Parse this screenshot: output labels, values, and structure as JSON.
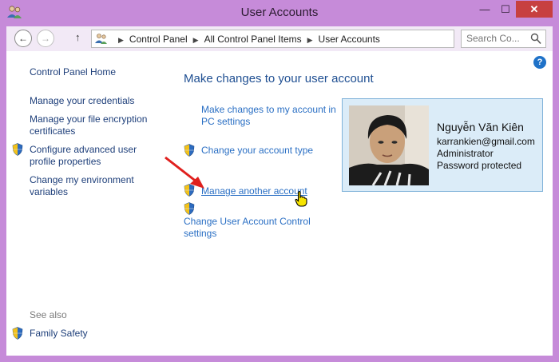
{
  "window": {
    "title": "User Accounts",
    "minimize": "—",
    "maximize": "☐",
    "close": "✕"
  },
  "nav": {
    "back": "←",
    "forward": "→",
    "up": "↑",
    "breadcrumbs": [
      "Control Panel",
      "All Control Panel Items",
      "User Accounts"
    ],
    "search_placeholder": "Search Co...",
    "refresh": "↻"
  },
  "sidebar": {
    "home": "Control Panel Home",
    "items": [
      {
        "label": "Manage your credentials",
        "shield": false
      },
      {
        "label": "Manage your file encryption certificates",
        "shield": false
      },
      {
        "label": "Configure advanced user profile properties",
        "shield": true
      },
      {
        "label": "Change my environment variables",
        "shield": false
      }
    ],
    "see_also": "See also",
    "see_also_items": [
      {
        "label": "Family Safety",
        "shield": true
      }
    ]
  },
  "main": {
    "heading": "Make changes to your user account",
    "links": [
      {
        "label": "Make changes to my account in PC settings",
        "shield": false
      },
      {
        "label": "Change your account type",
        "shield": true
      },
      {
        "label": "Manage another account",
        "shield": true
      },
      {
        "label": "Change User Account Control settings",
        "shield": true
      }
    ]
  },
  "account": {
    "name": "Nguyễn Văn Kiên",
    "email": "karrankien@gmail.com",
    "role": "Administrator",
    "password_status": "Password protected"
  },
  "help": "?",
  "colors": {
    "frame": "#c68bd9",
    "link": "#2a6fc4",
    "heading": "#1f4f92",
    "card_bg": "#dbecf8",
    "close": "#c74040"
  }
}
